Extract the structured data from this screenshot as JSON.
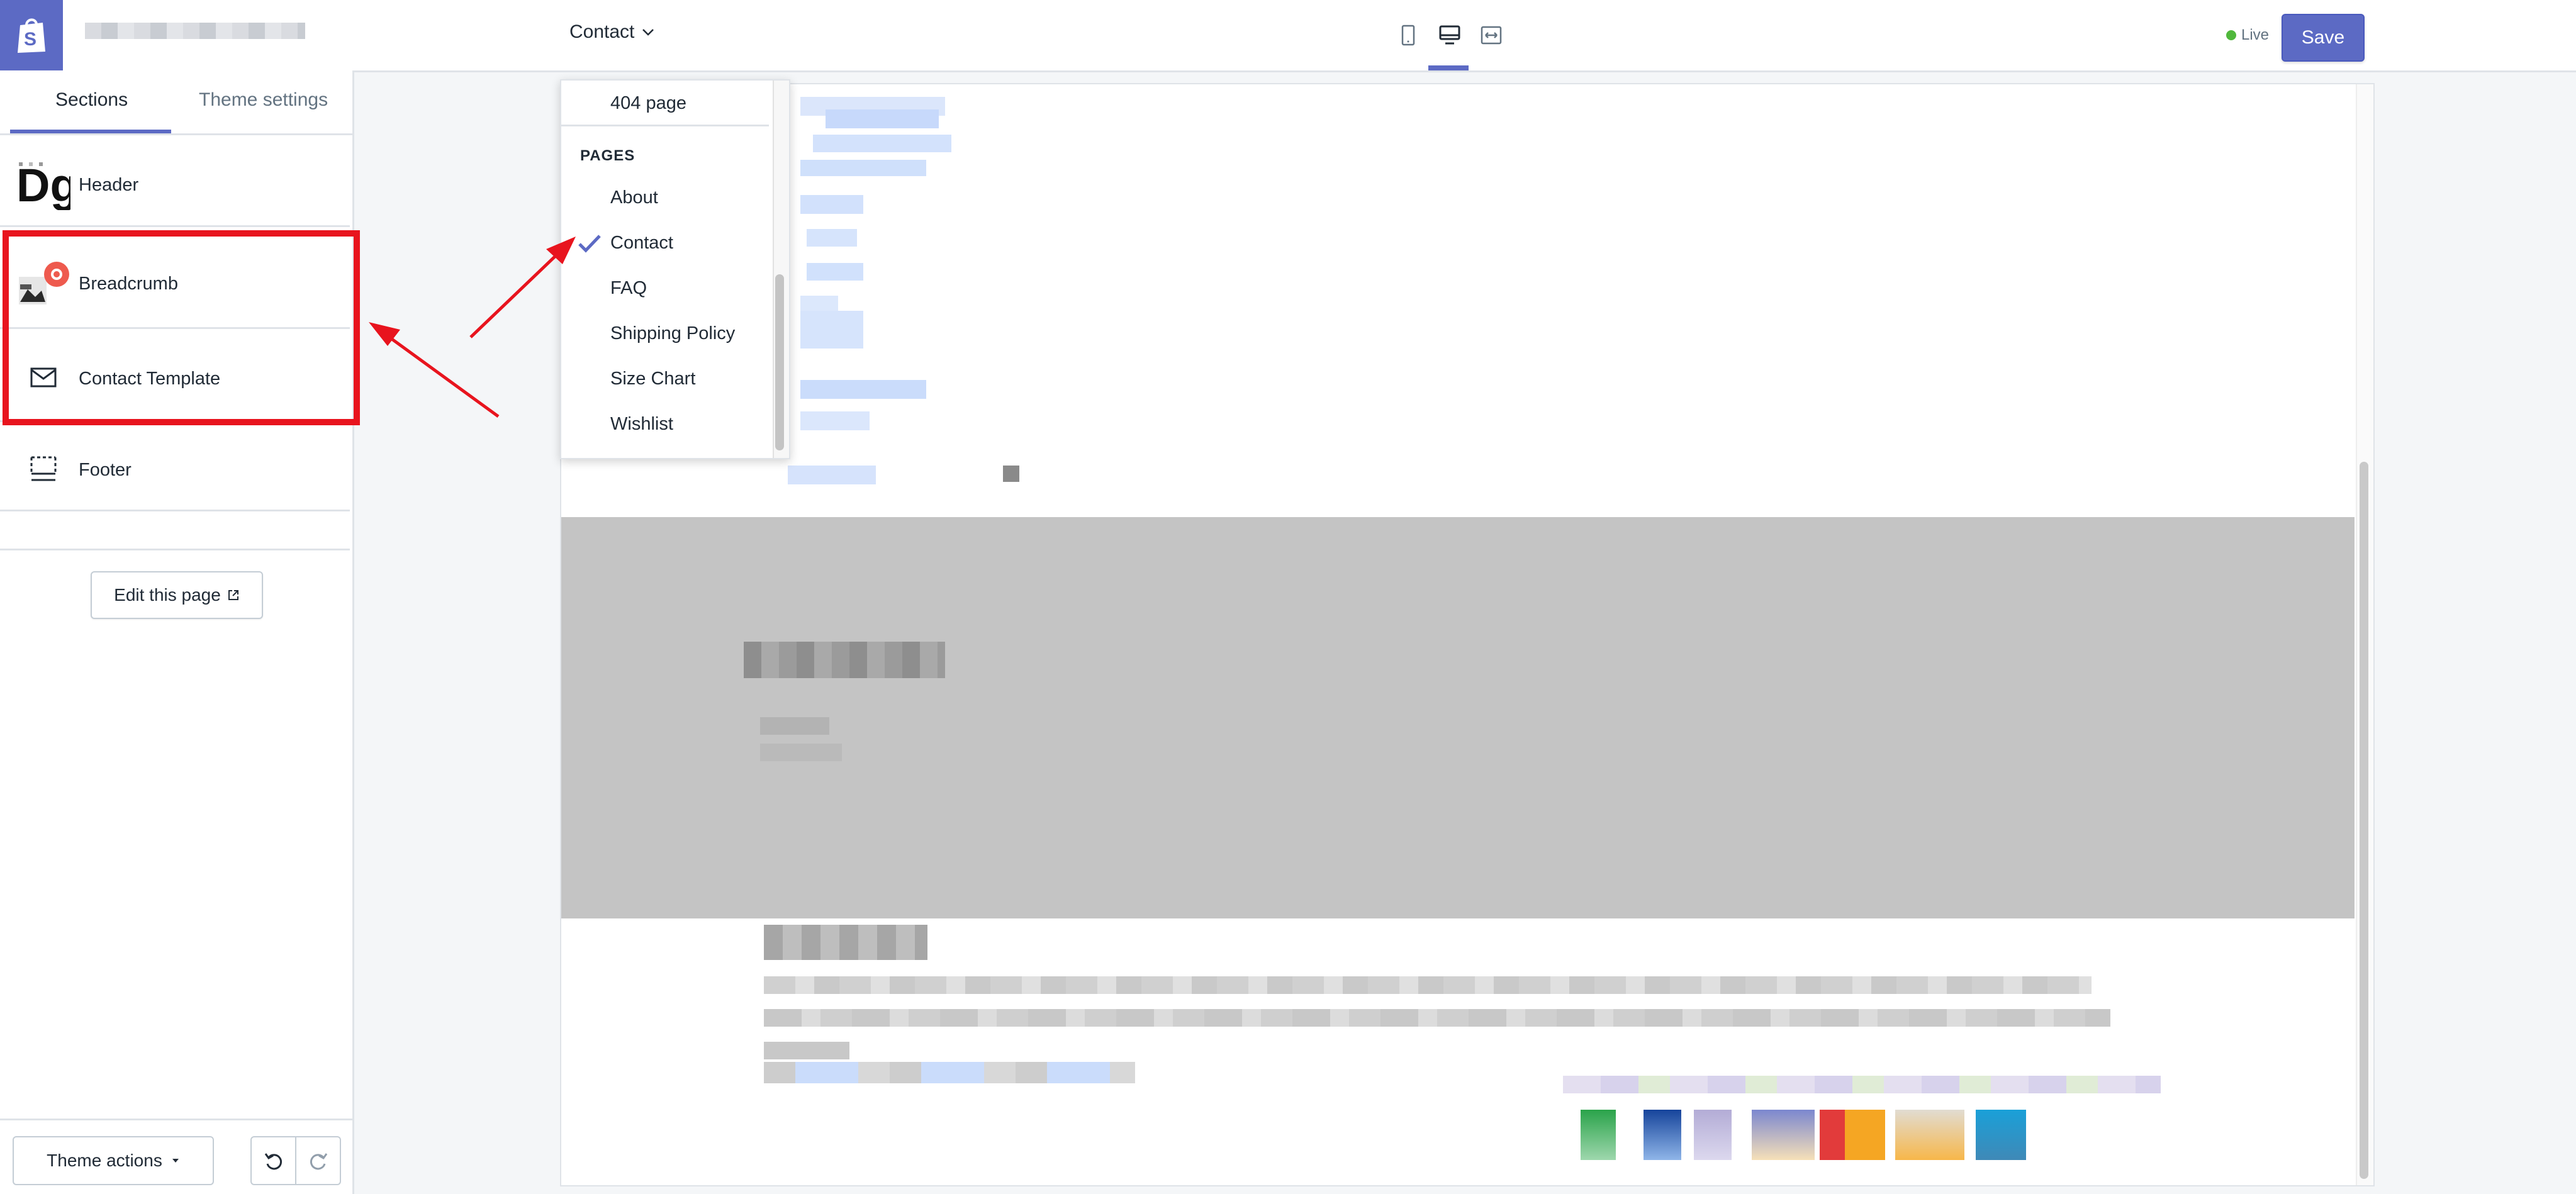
{
  "topbar": {
    "page_selector": "Contact",
    "live_label": "Live",
    "save_label": "Save"
  },
  "sidebar": {
    "tabs": [
      {
        "label": "Sections"
      },
      {
        "label": "Theme settings"
      }
    ],
    "sections": [
      {
        "label": "Header",
        "icon": "header-logo-icon"
      },
      {
        "label": "Breadcrumb",
        "icon": "breadcrumb-image-icon"
      },
      {
        "label": "Contact Template",
        "icon": "envelope-icon"
      },
      {
        "label": "Footer",
        "icon": "footer-layout-icon"
      }
    ],
    "edit_page_label": "Edit this page",
    "theme_actions_label": "Theme actions"
  },
  "dropdown": {
    "top_item": "404 page",
    "heading": "PAGES",
    "items": [
      "About",
      "Contact",
      "FAQ",
      "Shipping Policy",
      "Size Chart",
      "Wishlist"
    ],
    "selected": "Contact"
  },
  "colors": {
    "accent": "#5c6ac4",
    "live_dot": "#50b83c",
    "highlight": "#e8141e"
  }
}
